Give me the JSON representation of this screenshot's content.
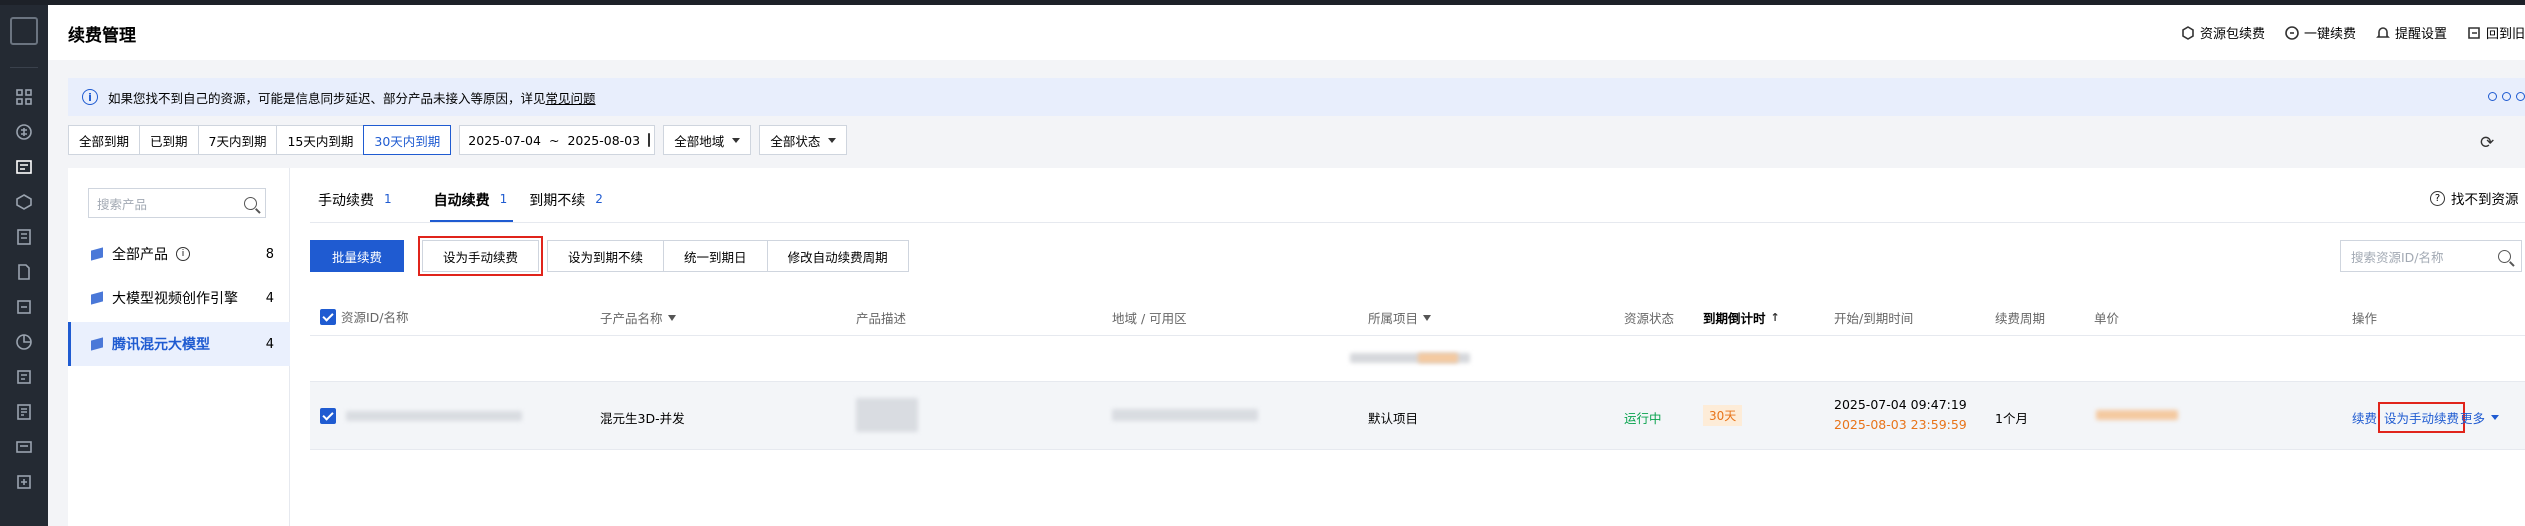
{
  "header": {
    "title": "续费管理",
    "actions": [
      "资源包续费",
      "一键续费",
      "提醒设置",
      "回到旧"
    ]
  },
  "notice": {
    "text": "如果您找不到自己的资源，可能是信息同步延迟、部分产品未接入等原因，详见",
    "link": "常见问题"
  },
  "filters": {
    "period_tabs": [
      "全部到期",
      "已到期",
      "7天内到期",
      "15天内到期",
      "30天内到期"
    ],
    "active_period": "30天内到期",
    "date_start": "2025-07-04",
    "date_sep": "~",
    "date_end": "2025-08-03",
    "region": "全部地域",
    "status": "全部状态"
  },
  "sidebar": {
    "search_placeholder": "搜索产品",
    "items": [
      {
        "label": "全部产品",
        "count": "8"
      },
      {
        "label": "大模型视频创作引擎",
        "count": "4"
      },
      {
        "label": "腾讯混元大模型",
        "count": "4"
      }
    ]
  },
  "tabs": [
    {
      "label": "手动续费",
      "count": "1"
    },
    {
      "label": "自动续费",
      "count": "1"
    },
    {
      "label": "到期不续",
      "count": "2"
    }
  ],
  "help_link": "找不到资源",
  "actions": {
    "batch_renew": "批量续费",
    "set_manual": "设为手动续费",
    "set_no_renew": "设为到期不续",
    "unify_expiry": "统一到期日",
    "modify_period": "修改自动续费周期"
  },
  "search_placeholder": "搜索资源ID/名称",
  "table": {
    "columns": [
      "资源ID/名称",
      "子产品名称",
      "产品描述",
      "地域 / 可用区",
      "所属项目",
      "资源状态",
      "到期倒计时",
      "开始/到期时间",
      "续费周期",
      "单价",
      "操作"
    ],
    "row": {
      "sub_product": "混元生3D-并发",
      "project": "默认项目",
      "status": "运行中",
      "countdown": "30天",
      "start_time": "2025-07-04 09:47:19",
      "end_time": "2025-08-03 23:59:59",
      "period": "1个月",
      "op_renew": "续费",
      "op_set_manual": "设为手动续费",
      "op_more": "更多"
    }
  },
  "colors": {
    "primary": "#1f5bd1",
    "highlight": "#e0241b",
    "running": "#0aa34f",
    "warning": "#e8741a"
  }
}
